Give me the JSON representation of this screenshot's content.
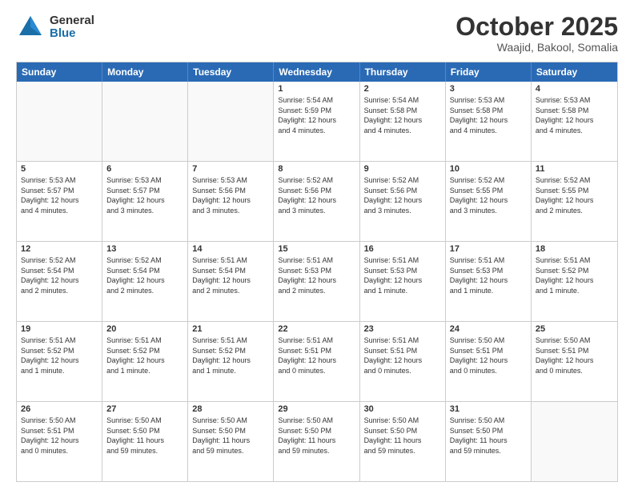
{
  "logo": {
    "general": "General",
    "blue": "Blue"
  },
  "title": "October 2025",
  "location": "Waajid, Bakool, Somalia",
  "days_of_week": [
    "Sunday",
    "Monday",
    "Tuesday",
    "Wednesday",
    "Thursday",
    "Friday",
    "Saturday"
  ],
  "weeks": [
    [
      {
        "day": "",
        "detail": "",
        "empty": true
      },
      {
        "day": "",
        "detail": "",
        "empty": true
      },
      {
        "day": "",
        "detail": "",
        "empty": true
      },
      {
        "day": "1",
        "detail": "Sunrise: 5:54 AM\nSunset: 5:59 PM\nDaylight: 12 hours\nand 4 minutes."
      },
      {
        "day": "2",
        "detail": "Sunrise: 5:54 AM\nSunset: 5:58 PM\nDaylight: 12 hours\nand 4 minutes."
      },
      {
        "day": "3",
        "detail": "Sunrise: 5:53 AM\nSunset: 5:58 PM\nDaylight: 12 hours\nand 4 minutes."
      },
      {
        "day": "4",
        "detail": "Sunrise: 5:53 AM\nSunset: 5:58 PM\nDaylight: 12 hours\nand 4 minutes."
      }
    ],
    [
      {
        "day": "5",
        "detail": "Sunrise: 5:53 AM\nSunset: 5:57 PM\nDaylight: 12 hours\nand 4 minutes."
      },
      {
        "day": "6",
        "detail": "Sunrise: 5:53 AM\nSunset: 5:57 PM\nDaylight: 12 hours\nand 3 minutes."
      },
      {
        "day": "7",
        "detail": "Sunrise: 5:53 AM\nSunset: 5:56 PM\nDaylight: 12 hours\nand 3 minutes."
      },
      {
        "day": "8",
        "detail": "Sunrise: 5:52 AM\nSunset: 5:56 PM\nDaylight: 12 hours\nand 3 minutes."
      },
      {
        "day": "9",
        "detail": "Sunrise: 5:52 AM\nSunset: 5:56 PM\nDaylight: 12 hours\nand 3 minutes."
      },
      {
        "day": "10",
        "detail": "Sunrise: 5:52 AM\nSunset: 5:55 PM\nDaylight: 12 hours\nand 3 minutes."
      },
      {
        "day": "11",
        "detail": "Sunrise: 5:52 AM\nSunset: 5:55 PM\nDaylight: 12 hours\nand 2 minutes."
      }
    ],
    [
      {
        "day": "12",
        "detail": "Sunrise: 5:52 AM\nSunset: 5:54 PM\nDaylight: 12 hours\nand 2 minutes."
      },
      {
        "day": "13",
        "detail": "Sunrise: 5:52 AM\nSunset: 5:54 PM\nDaylight: 12 hours\nand 2 minutes."
      },
      {
        "day": "14",
        "detail": "Sunrise: 5:51 AM\nSunset: 5:54 PM\nDaylight: 12 hours\nand 2 minutes."
      },
      {
        "day": "15",
        "detail": "Sunrise: 5:51 AM\nSunset: 5:53 PM\nDaylight: 12 hours\nand 2 minutes."
      },
      {
        "day": "16",
        "detail": "Sunrise: 5:51 AM\nSunset: 5:53 PM\nDaylight: 12 hours\nand 1 minute."
      },
      {
        "day": "17",
        "detail": "Sunrise: 5:51 AM\nSunset: 5:53 PM\nDaylight: 12 hours\nand 1 minute."
      },
      {
        "day": "18",
        "detail": "Sunrise: 5:51 AM\nSunset: 5:52 PM\nDaylight: 12 hours\nand 1 minute."
      }
    ],
    [
      {
        "day": "19",
        "detail": "Sunrise: 5:51 AM\nSunset: 5:52 PM\nDaylight: 12 hours\nand 1 minute."
      },
      {
        "day": "20",
        "detail": "Sunrise: 5:51 AM\nSunset: 5:52 PM\nDaylight: 12 hours\nand 1 minute."
      },
      {
        "day": "21",
        "detail": "Sunrise: 5:51 AM\nSunset: 5:52 PM\nDaylight: 12 hours\nand 1 minute."
      },
      {
        "day": "22",
        "detail": "Sunrise: 5:51 AM\nSunset: 5:51 PM\nDaylight: 12 hours\nand 0 minutes."
      },
      {
        "day": "23",
        "detail": "Sunrise: 5:51 AM\nSunset: 5:51 PM\nDaylight: 12 hours\nand 0 minutes."
      },
      {
        "day": "24",
        "detail": "Sunrise: 5:50 AM\nSunset: 5:51 PM\nDaylight: 12 hours\nand 0 minutes."
      },
      {
        "day": "25",
        "detail": "Sunrise: 5:50 AM\nSunset: 5:51 PM\nDaylight: 12 hours\nand 0 minutes."
      }
    ],
    [
      {
        "day": "26",
        "detail": "Sunrise: 5:50 AM\nSunset: 5:51 PM\nDaylight: 12 hours\nand 0 minutes."
      },
      {
        "day": "27",
        "detail": "Sunrise: 5:50 AM\nSunset: 5:50 PM\nDaylight: 11 hours\nand 59 minutes."
      },
      {
        "day": "28",
        "detail": "Sunrise: 5:50 AM\nSunset: 5:50 PM\nDaylight: 11 hours\nand 59 minutes."
      },
      {
        "day": "29",
        "detail": "Sunrise: 5:50 AM\nSunset: 5:50 PM\nDaylight: 11 hours\nand 59 minutes."
      },
      {
        "day": "30",
        "detail": "Sunrise: 5:50 AM\nSunset: 5:50 PM\nDaylight: 11 hours\nand 59 minutes."
      },
      {
        "day": "31",
        "detail": "Sunrise: 5:50 AM\nSunset: 5:50 PM\nDaylight: 11 hours\nand 59 minutes."
      },
      {
        "day": "",
        "detail": "",
        "empty": true
      }
    ]
  ]
}
